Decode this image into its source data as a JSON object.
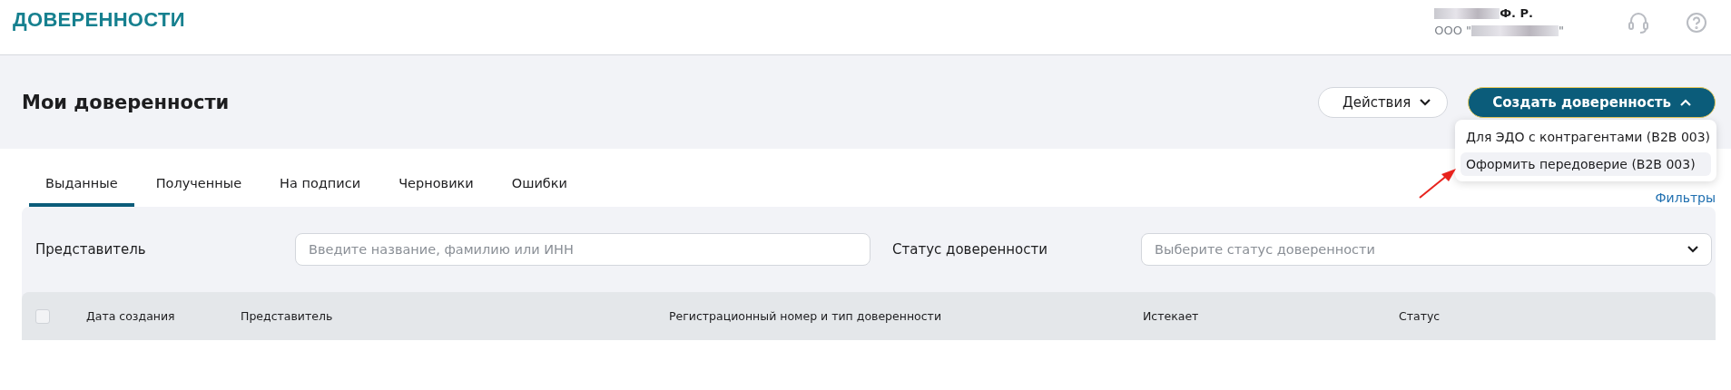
{
  "header": {
    "logo": "ДОВЕРЕННОСТИ",
    "user": {
      "name": "Ф. Р.",
      "org_prefix": "ООО \"",
      "org_suffix": "\""
    }
  },
  "page": {
    "title": "Мои доверенности",
    "actions_button": "Действия",
    "create_button": "Создать доверенность",
    "create_expanded": true
  },
  "create_menu": [
    {
      "label": "Для ЭДО с контрагентами (B2B 003)",
      "selected": false
    },
    {
      "label": "Оформить передоверие (B2B 003)",
      "selected": true
    }
  ],
  "tabs": [
    {
      "label": "Выданные",
      "selected": true
    },
    {
      "label": "Полученные",
      "selected": false
    },
    {
      "label": "На подписи",
      "selected": false
    },
    {
      "label": "Черновики",
      "selected": false
    },
    {
      "label": "Ошибки",
      "selected": false
    }
  ],
  "filters_link": "Фильтры",
  "filters": {
    "representative_label": "Представитель",
    "representative_placeholder": "Введите название, фамилию или ИНН",
    "status_label": "Статус доверенности",
    "status_placeholder": "Выберите статус доверенности"
  },
  "table": {
    "select_all_checked": false,
    "columns": [
      "Дата создания",
      "Представитель",
      "Регистрационный номер и тип доверенности",
      "Истекает",
      "Статус"
    ]
  }
}
